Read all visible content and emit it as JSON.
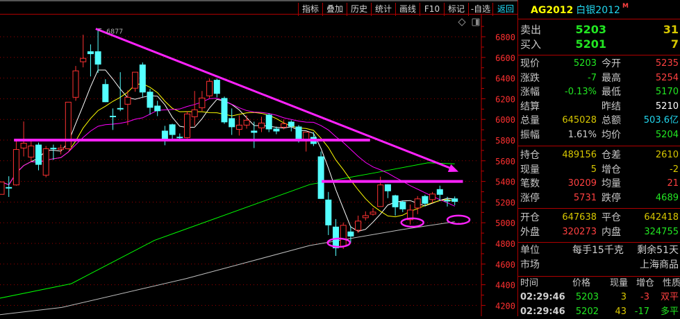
{
  "toolbar": [
    "指标",
    "叠加",
    "历史",
    "统计",
    "画线",
    "F10",
    "标记",
    "-自选",
    "返回"
  ],
  "panel": {
    "code": "AG2012",
    "name": "白银2012",
    "flag": "M",
    "orderbook": [
      {
        "label": "卖出",
        "price": "5203",
        "volume": "31"
      },
      {
        "label": "买入",
        "price": "5201",
        "volume": "7"
      }
    ],
    "quote": [
      {
        "l1": "现价",
        "v1": "5203",
        "c1": "g",
        "l2": "今开",
        "v2": "5235",
        "c2": "r"
      },
      {
        "l1": "涨跌",
        "v1": "-7",
        "c1": "g",
        "l2": "最高",
        "v2": "5254",
        "c2": "r"
      },
      {
        "l1": "涨幅",
        "v1": "-0.13%",
        "c1": "g",
        "l2": "最低",
        "v2": "5170",
        "c2": "g"
      },
      {
        "l1": "结算",
        "v1": "",
        "c1": "w",
        "l2": "昨结",
        "v2": "5210",
        "c2": "w"
      },
      {
        "l1": "总量",
        "v1": "645028",
        "c1": "y",
        "l2": "总额",
        "v2": "503.6亿",
        "c2": "c"
      },
      {
        "l1": "振幅",
        "v1": "1.61%",
        "c1": "lg",
        "l2": "均价",
        "v2": "5204",
        "c2": "g"
      }
    ],
    "position": [
      {
        "l1": "持仓",
        "v1": "489156",
        "c1": "y",
        "l2": "仓差",
        "v2": "2610",
        "c2": "y"
      },
      {
        "l1": "现量",
        "v1": "5",
        "c1": "y",
        "l2": "增仓",
        "v2": "-2",
        "c2": "y"
      },
      {
        "l1": "笔数",
        "v1": "30209",
        "c1": "r",
        "l2": "均量",
        "v2": "21",
        "c2": "r"
      },
      {
        "l1": "涨停",
        "v1": "5731",
        "c1": "r",
        "l2": "跌停",
        "v2": "4689",
        "c2": "g"
      }
    ],
    "flow": [
      {
        "l1": "开仓",
        "v1": "647638",
        "c1": "y",
        "l2": "平仓",
        "v2": "642418",
        "c2": "y"
      },
      {
        "l1": "外盘",
        "v1": "320273",
        "c1": "r",
        "l2": "内盘",
        "v2": "324755",
        "c2": "g"
      }
    ],
    "info": {
      "unit_label": "单位",
      "unit_value": "每手15千克",
      "remaining": "剩余51天",
      "market_label": "市场",
      "market_value": "上海商品"
    },
    "trades_header": [
      "时间",
      "价格",
      "现量",
      "增仓",
      "性质"
    ],
    "trades": [
      {
        "time": "02:29:46",
        "price": "5203",
        "vol": "3",
        "chg": "-3",
        "chg_c": "r",
        "nature": "双平",
        "nature_c": "r"
      },
      {
        "time": "02:29:46",
        "price": "5202",
        "vol": "43",
        "chg": "-17",
        "chg_c": "g",
        "nature": "多平",
        "nature_c": "g"
      }
    ]
  },
  "chart_data": {
    "type": "candlestick",
    "instrument": "AG2012",
    "high_label": "6877",
    "yticks": [
      6800,
      6600,
      6400,
      6200,
      6000,
      5800,
      5600,
      5400,
      5200,
      5000,
      4800,
      4600,
      4400,
      4200
    ],
    "ylim": [
      4090,
      6990
    ],
    "grid": true,
    "colors": {
      "up": "#ff3232",
      "down": "#54ffff",
      "annotation": "#ff22ff"
    },
    "ohlc": [
      [
        5275,
        5395,
        5275,
        5395
      ],
      [
        5345,
        5450,
        5250,
        5340
      ],
      [
        5366,
        5790,
        5359,
        5709
      ],
      [
        5723,
        5980,
        5642,
        5770
      ],
      [
        5635,
        5810,
        5595,
        5743
      ],
      [
        5756,
        5776,
        5507,
        5561
      ],
      [
        5460,
        5743,
        5440,
        5716
      ],
      [
        5725,
        5756,
        5608,
        5720
      ],
      [
        5709,
        5756,
        5662,
        5723
      ],
      [
        5716,
        6167,
        5709,
        6167
      ],
      [
        6214,
        6517,
        6180,
        6470
      ],
      [
        6558,
        6820,
        6504,
        6591
      ],
      [
        6659,
        6726,
        6416,
        6632
      ],
      [
        6659,
        6877,
        6450,
        6531
      ],
      [
        6342,
        6389,
        6167,
        6167
      ],
      [
        6035,
        6106,
        5898,
        6032
      ],
      [
        6110,
        6457,
        6080,
        6106
      ],
      [
        6147,
        6281,
        5945,
        6214
      ],
      [
        6302,
        6457,
        6268,
        6457
      ],
      [
        6531,
        6551,
        6214,
        6261
      ],
      [
        6268,
        6295,
        6046,
        6113
      ],
      [
        6133,
        6180,
        6032,
        6080
      ],
      [
        5891,
        5938,
        5750,
        5797
      ],
      [
        5952,
        5958,
        5803,
        5850
      ],
      [
        5832,
        5864,
        5810,
        5830
      ],
      [
        5824,
        6080,
        5817,
        6053
      ],
      [
        6026,
        6275,
        5938,
        6093
      ],
      [
        6113,
        6275,
        6080,
        6207
      ],
      [
        6228,
        6396,
        6207,
        6369
      ],
      [
        6383,
        6396,
        6214,
        6248
      ],
      [
        6207,
        6221,
        5958,
        5972
      ],
      [
        6012,
        6106,
        5850,
        5925
      ],
      [
        5904,
        6039,
        5844,
        5945
      ],
      [
        5945,
        6039,
        5911,
        5992
      ],
      [
        5891,
        5978,
        5723,
        5871
      ],
      [
        5918,
        6026,
        5877,
        5965
      ],
      [
        6046,
        6059,
        5877,
        5904
      ],
      [
        5911,
        5931,
        5857,
        5884
      ],
      [
        5925,
        5999,
        5904,
        5958
      ],
      [
        5978,
        5992,
        5884,
        5931
      ],
      [
        5931,
        5945,
        5776,
        5797
      ],
      [
        5797,
        5877,
        5689,
        5877
      ],
      [
        5830,
        5877,
        5743,
        5763
      ],
      [
        5642,
        5689,
        5231,
        5231
      ],
      [
        5224,
        5298,
        4881,
        4975
      ],
      [
        4962,
        5036,
        4679,
        4753
      ],
      [
        4773,
        5002,
        4746,
        4975
      ],
      [
        4915,
        4968,
        4807,
        4867
      ],
      [
        4928,
        5069,
        4901,
        5016
      ],
      [
        5049,
        5110,
        5022,
        5069
      ],
      [
        5083,
        5143,
        5069,
        5103
      ],
      [
        5157,
        5446,
        5157,
        5366
      ],
      [
        5372,
        5372,
        5238,
        5305
      ],
      [
        5265,
        5271,
        5069,
        5150
      ],
      [
        5204,
        5217,
        5103,
        5130
      ],
      [
        5029,
        5177,
        4982,
        5123
      ],
      [
        5143,
        5258,
        5083,
        5231
      ],
      [
        5258,
        5271,
        5157,
        5184
      ],
      [
        5224,
        5298,
        5190,
        5278
      ],
      [
        5325,
        5359,
        5211,
        5271
      ],
      [
        5220,
        5251,
        5157,
        5215
      ],
      [
        5235,
        5254,
        5170,
        5203
      ]
    ],
    "moving_averages": [
      {
        "name": "MA5",
        "period": 5,
        "color": "#ffffff"
      },
      {
        "name": "MA10",
        "period": 10,
        "color": "#ffff00"
      },
      {
        "name": "MA20",
        "period": 20,
        "color": "#ff00ff"
      }
    ],
    "long_averages": [
      {
        "name": "MA60",
        "color": "#00ff00",
        "points": [
          [
            -0.2,
            4270
          ],
          [
            9.4,
            4410
          ],
          [
            20.6,
            4830
          ],
          [
            41.5,
            5370
          ],
          [
            50,
            5480
          ],
          [
            57.4,
            5580
          ],
          [
            61,
            5570
          ]
        ]
      },
      {
        "name": "MA120",
        "color": "#c0c0c0",
        "points": [
          [
            -0.2,
            4110
          ],
          [
            8.1,
            4180
          ],
          [
            24.9,
            4460
          ],
          [
            41.5,
            4780
          ],
          [
            54,
            4935
          ],
          [
            61,
            5010
          ]
        ]
      }
    ],
    "annotations": [
      {
        "type": "hline",
        "price": 5800,
        "from": 1.7,
        "to": 49.6
      },
      {
        "type": "hline",
        "price": 5400,
        "from": 43.1,
        "to": 62.1
      },
      {
        "type": "arrow",
        "from": [
          12.7,
          6877
        ],
        "to": [
          61.5,
          5494
        ]
      },
      {
        "type": "ellipse",
        "center": [
          45.4,
          4807
        ]
      },
      {
        "type": "ellipse",
        "center": [
          55.3,
          5002
        ]
      },
      {
        "type": "ellipse",
        "center": [
          61.5,
          5029
        ]
      }
    ]
  }
}
